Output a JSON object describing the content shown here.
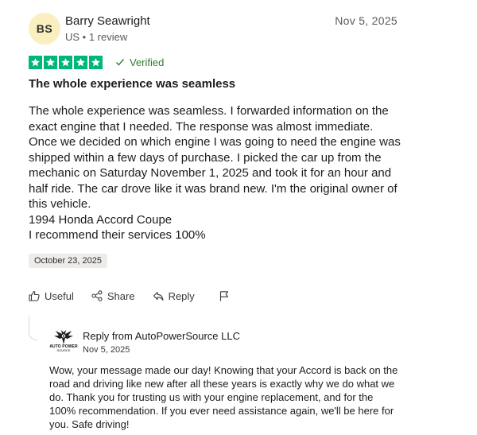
{
  "reviewer": {
    "initials": "BS",
    "name": "Barry Seawright",
    "meta": "US • 1 review",
    "avatar_color": "#f9efbf"
  },
  "review": {
    "date": "Nov 5, 2025",
    "rating": 5,
    "rating_max": 5,
    "star_color": "#00b67a",
    "verified_label": "Verified",
    "title": "The whole experience was seamless",
    "body_paragraphs": [
      "The whole experience was seamless. I forwarded information on the exact engine that I needed. The response was almost immediate. Once we decided on which engine I was going to need the engine was shipped within a few days of purchase. I picked the car up from the mechanic on Saturday November 1, 2025 and took it for an hour and half ride. The car drove like it was brand new. I'm the original owner of this vehicle.",
      "1994 Honda Accord Coupe",
      "I recommend their services 100%"
    ],
    "experience_date": "October 23, 2025"
  },
  "actions": {
    "useful_label": "Useful",
    "share_label": "Share",
    "reply_label": "Reply"
  },
  "reply": {
    "from_label": "Reply from AutoPowerSource LLC",
    "date": "Nov 5, 2025",
    "logo_text": "AUTO POWER",
    "logo_subtext": "SOURCE",
    "body": "Wow, your message made our day! Knowing that your Accord is back on the road and driving like new after all these years is exactly why we do what we do. Thank you for trusting us with your engine replacement, and for the 100% recommendation. If you ever need assistance again, we'll be here for you. Safe driving!"
  }
}
